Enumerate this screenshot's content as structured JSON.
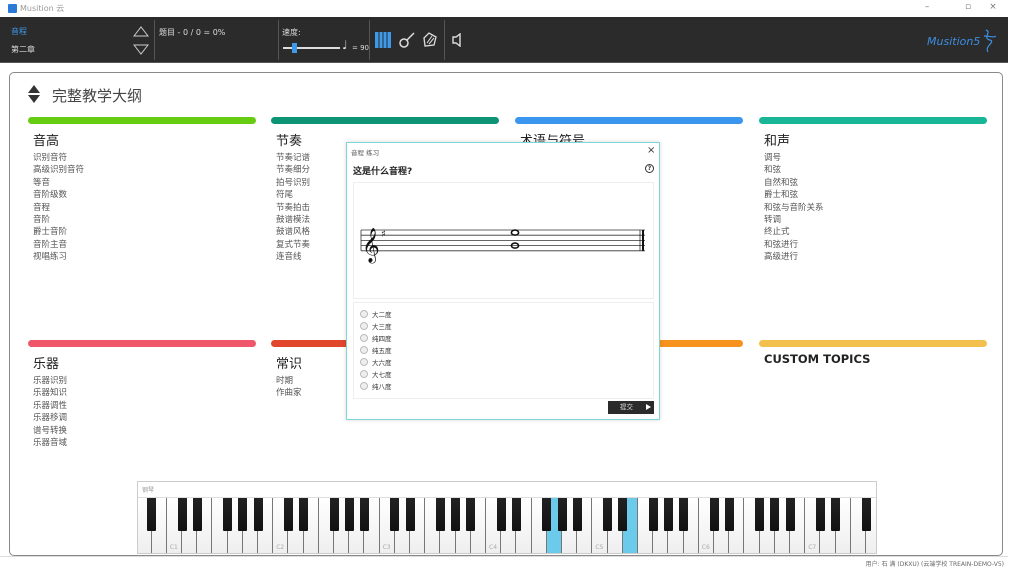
{
  "window": {
    "title": "Musition 云",
    "minimize": "–",
    "restore": "▫",
    "close": "×"
  },
  "toolbar": {
    "topic": "音程",
    "chapter": "第二章",
    "score_label": "题目 - 0 / 0 = 0%",
    "tempo_label": "速度:",
    "tempo_value": "= 90",
    "tempo_fraction": 0.15,
    "logo": "Musition5"
  },
  "main": {
    "title": "完整教学大纲",
    "columns": [
      {
        "heading": "音高",
        "color": "#66cc11",
        "items": [
          "识别音符",
          "高级识别音符",
          "等音",
          "音阶级数",
          "音程",
          "音阶",
          "爵士音阶",
          "音阶主音",
          "视唱练习"
        ]
      },
      {
        "heading": "节奏",
        "color": "#0c9474",
        "items": [
          "节奏记谱",
          "节奏细分",
          "拍号识别",
          "符尾",
          "节奏拍击",
          "鼓谱模法",
          "鼓谱风格",
          "复式节奏",
          "连音线"
        ]
      },
      {
        "heading": "术语与符号",
        "color": "#3a96ee",
        "items": []
      },
      {
        "heading": "和声",
        "color": "#18b596",
        "items": [
          "调号",
          "和弦",
          "自然和弦",
          "爵士和弦",
          "和弦与音阶关系",
          "转调",
          "终止式",
          "和弦进行",
          "高级进行"
        ]
      },
      {
        "heading": "乐器",
        "color": "#f0566a",
        "items": [
          "乐器识别",
          "乐器知识",
          "乐器调性",
          "乐器移调",
          "谱号转换",
          "乐器音域"
        ]
      },
      {
        "heading": "常识",
        "color": "#e0472c",
        "items": [
          "时期",
          "作曲家"
        ]
      },
      {
        "heading": "",
        "color": "#f7921e",
        "items": []
      },
      {
        "heading": "CUSTOM TOPICS",
        "color": "#f2c04c",
        "items": []
      }
    ]
  },
  "dialog": {
    "title": "音程 练习",
    "close": "×",
    "question": "这是什么音程?",
    "help": "?",
    "options": [
      "大二度",
      "大三度",
      "纯四度",
      "纯五度",
      "大六度",
      "大七度",
      "纯八度"
    ],
    "submit": "提交"
  },
  "piano": {
    "label": "钢琴",
    "highlighted": [
      "G4",
      "E5"
    ],
    "highlight_color": "#6ccbea"
  },
  "footer": {
    "user": "用户: 石 满 (DKXU) (云端学校 TREAIN-DEMO-V5)"
  }
}
